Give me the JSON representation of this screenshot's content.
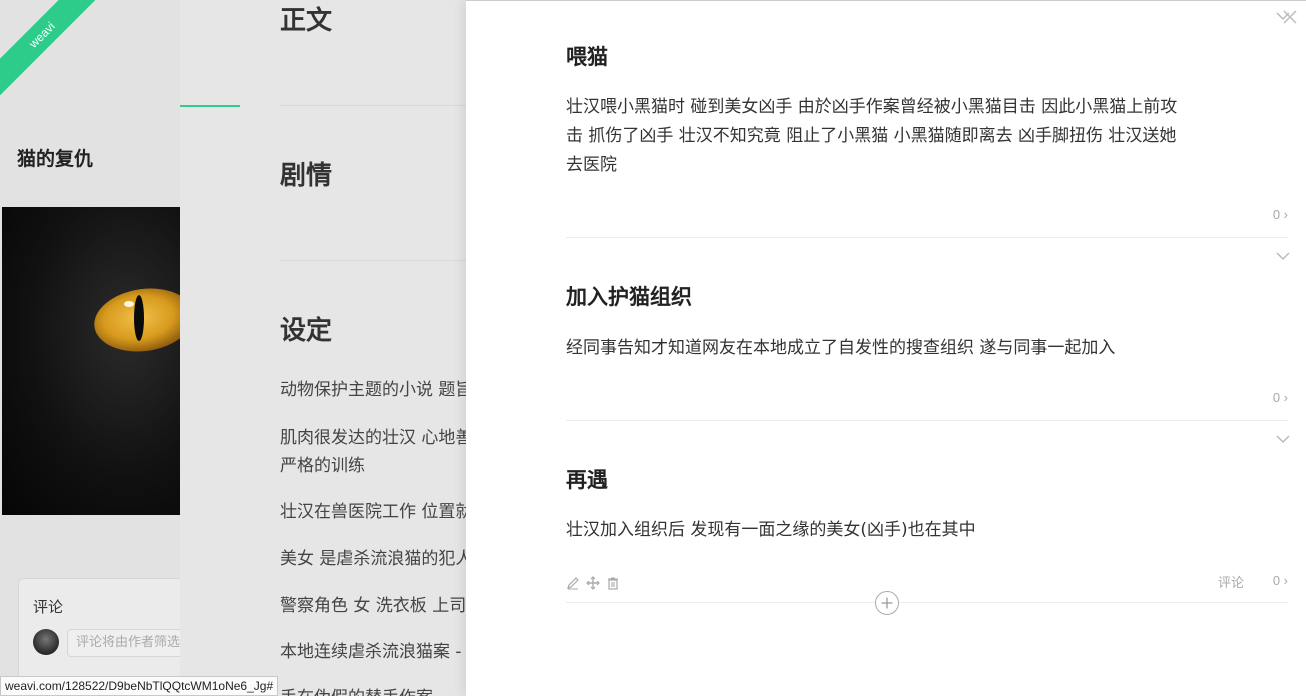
{
  "sidebar": {
    "ribbon_text": "weavi",
    "story_title": "猫的复仇",
    "comment_title": "评论",
    "comment_placeholder": "评论将由作者筛选"
  },
  "middle": {
    "headings": [
      "正文",
      "剧情",
      "设定"
    ],
    "settings_lines": [
      "动物保护主题的小说 题旨",
      "肌肉很发达的壮汉 心地善",
      "严格的训练",
      "壮汉在兽医院工作 位置就",
      "美女 是虐杀流浪猫的犯人",
      "警察角色 女 洗衣板 上司",
      "本地连续虐杀流浪猫案 -",
      "手在伪假的替手作案"
    ]
  },
  "status_bar": {
    "url": "weavi.com/128522/D9beNbTlQQtcWM1oNe6_Jg#"
  },
  "panel": {
    "chapters": [
      {
        "title": "喂猫",
        "body_lines": [
          "壮汉喂小黑猫时 碰到美女凶手 由於凶手作案曾经被小黑猫目击 因此小黑猫上前攻",
          "击 抓伤了凶手 壮汉不知究竟 阻止了小黑猫 小黑猫随即离去 凶手脚扭伤 壮汉送她",
          "去医院"
        ],
        "count": "0 ›"
      },
      {
        "title": "加入护猫组织",
        "body_lines": [
          "经同事告知才知道网友在本地成立了自发性的搜查组织 遂与同事一起加入"
        ],
        "count": "0 ›"
      },
      {
        "title": "再遇",
        "body_lines": [
          "壮汉加入组织后 发现有一面之缘的美女(凶手)也在其中"
        ],
        "count": "0 ›",
        "comment_label": "评论"
      }
    ]
  }
}
